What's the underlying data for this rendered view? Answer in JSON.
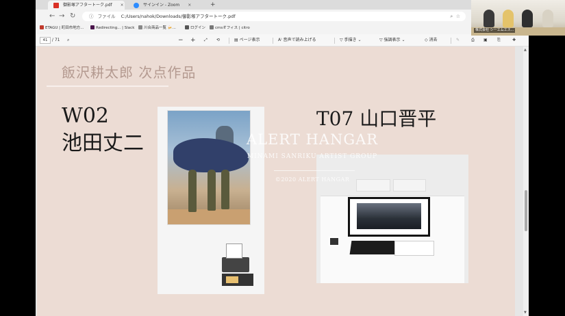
{
  "browser": {
    "tabs": [
      {
        "label": "御影塚アフタートーク.pdf",
        "icon_color": "#d93025",
        "active": true
      },
      {
        "label": "サインイン - Zoom",
        "icon_color": "#2d8cff",
        "active": false
      }
    ],
    "new_tab": "+",
    "address": {
      "scheme_label": "ファイル",
      "url": "C:/Users/nahok/Downloads/御影塚アフタートーク.pdf"
    },
    "bookmarks": [
      {
        "label": "ETAGU | 町田市地方...",
        "color": "#c0392b"
      },
      {
        "label": "Redirecting... | Slack",
        "color": "#4a154b"
      },
      {
        "label": "川合商品一覧 🍻...",
        "color": "#888888"
      },
      {
        "label": "ログイン",
        "color": "#555555"
      },
      {
        "label": "cmsオフィス | citro",
        "color": "#777777"
      }
    ]
  },
  "pdf_toolbar": {
    "page_current": "41",
    "page_total": "/ 71",
    "zoom_out": "−",
    "zoom_in": "+",
    "page_view": "ページ表示",
    "read_aloud": "音声で読み上げる",
    "draw": "手描き",
    "highlight": "強調表示",
    "erase": "消去"
  },
  "slide": {
    "title": "飯沢耕太郎 次点作品",
    "left_label_line1": "W02",
    "left_label_line2": "池田丈二",
    "right_label": "T07 山口晋平",
    "watermark_title": "ALERT HANGAR",
    "watermark_subtitle": "MINAMI SANRIKU ARTIST GROUP",
    "watermark_copyright": "©2020 ALERT HANGAR"
  },
  "webcam": {
    "name_label": "株式会社 シーエムエス..."
  }
}
